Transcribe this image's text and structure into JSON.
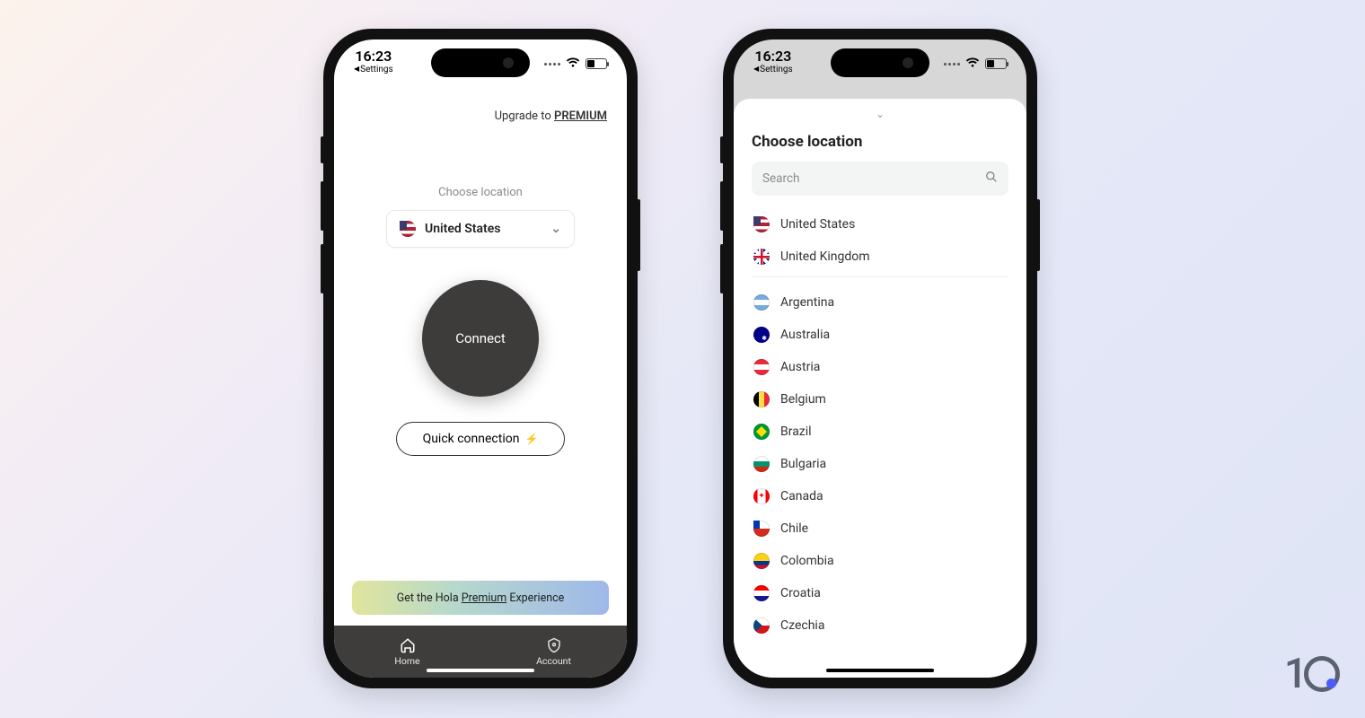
{
  "status": {
    "time": "16:23",
    "back_label": "Settings"
  },
  "home": {
    "upgrade_prefix": "Upgrade to ",
    "upgrade_premium": "PREMIUM",
    "choose_location_label": "Choose location",
    "selected_country": "United States",
    "connect_label": "Connect",
    "quick_connection_label": "Quick connection",
    "banner_prefix": "Get the Hola ",
    "banner_underline": "Premium",
    "banner_suffix": " Experience",
    "tab_home": "Home",
    "tab_account": "Account"
  },
  "sheet": {
    "title": "Choose location",
    "search_placeholder": "Search",
    "featured": [
      {
        "name": "United States",
        "flag": "us"
      },
      {
        "name": "United Kingdom",
        "flag": "uk"
      }
    ],
    "countries": [
      {
        "name": "Argentina",
        "flag": "ar"
      },
      {
        "name": "Australia",
        "flag": "au"
      },
      {
        "name": "Austria",
        "flag": "at"
      },
      {
        "name": "Belgium",
        "flag": "be"
      },
      {
        "name": "Brazil",
        "flag": "br"
      },
      {
        "name": "Bulgaria",
        "flag": "bg"
      },
      {
        "name": "Canada",
        "flag": "ca"
      },
      {
        "name": "Chile",
        "flag": "cl"
      },
      {
        "name": "Colombia",
        "flag": "co"
      },
      {
        "name": "Croatia",
        "flag": "hr"
      },
      {
        "name": "Czechia",
        "flag": "cz"
      }
    ]
  },
  "watermark": "1"
}
